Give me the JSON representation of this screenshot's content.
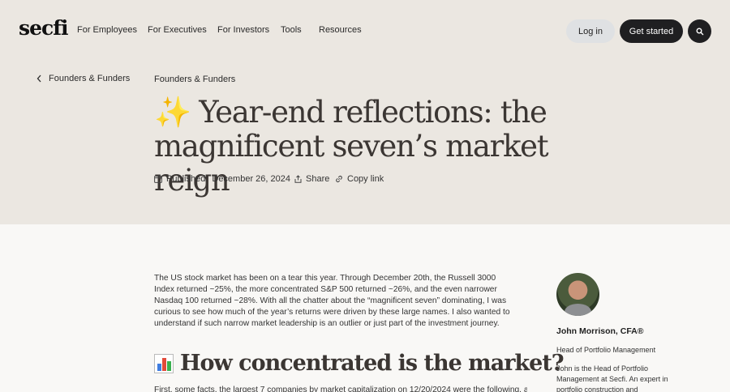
{
  "header": {
    "logo": "secfi",
    "nav": [
      "For Employees",
      "For Executives",
      "For Investors",
      "Tools",
      "Resources"
    ],
    "login_label": "Log in",
    "cta_label": "Get started",
    "search_icon": "search-icon"
  },
  "hero": {
    "back_label": "Founders & Funders",
    "category": "Founders & Funders",
    "title_emoji": "✨",
    "title": "Year-end reflections: the magnificent seven’s market reign",
    "published_label": "Published:",
    "published_date": "December 26, 2024",
    "share_label": "Share",
    "copy_link_label": "Copy link"
  },
  "article": {
    "intro": "The US stock market has been on a tear this year. Through December 20th, the Russell 3000 Index returned ~25%, the more concentrated S&P 500 returned ~26%, and the even narrower Nasdaq 100 returned ~28%. With all the chatter about the “magnificent seven” dominating, I was curious to see how much of the year’s returns were driven by these large names. I also wanted to understand if such narrow market leadership is an outlier or just part of the investment journey.",
    "section_icon": "bar-chart-icon",
    "section_heading": "How concentrated is the market?",
    "next_line": "First, some facts, the largest 7 companies by market capitalization on 12/20/2024 were the following, and"
  },
  "author": {
    "name": "John Morrison, CFA®",
    "role": "Head of Portfolio Management",
    "bio": "John is the Head of Portfolio Management at Secfi. An expert in portfolio construction and"
  },
  "colors": {
    "hero_bg": "#ebe7e1",
    "page_bg": "#f9f8f6",
    "dark_button": "#1f1f21",
    "light_button": "#dfe1e3"
  }
}
